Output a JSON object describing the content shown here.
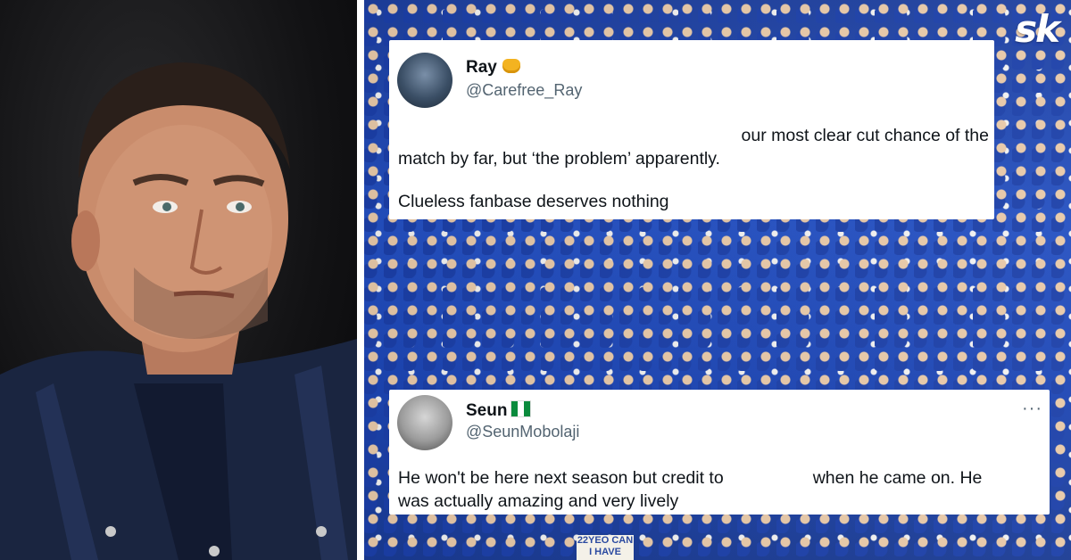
{
  "logo": "sk",
  "tweets": [
    {
      "name": "Ray",
      "handle": "@Carefree_Ray",
      "lines": [
        "our most clear cut chance of the",
        "match by far, but ‘the problem’ apparently.",
        "Clueless fanbase deserves nothing"
      ],
      "badge_icon": "raised-fist-emoji"
    },
    {
      "name": "Seun",
      "handle": "@SeunMobolaji",
      "more": "···",
      "lines": [
        "He won't be here next season but credit to",
        "when he came on. He",
        "was actually amazing and very lively"
      ],
      "badge_icon": "nigeria-flag-emoji"
    }
  ],
  "crowd_sign": "22YEO CAN I HAVE"
}
